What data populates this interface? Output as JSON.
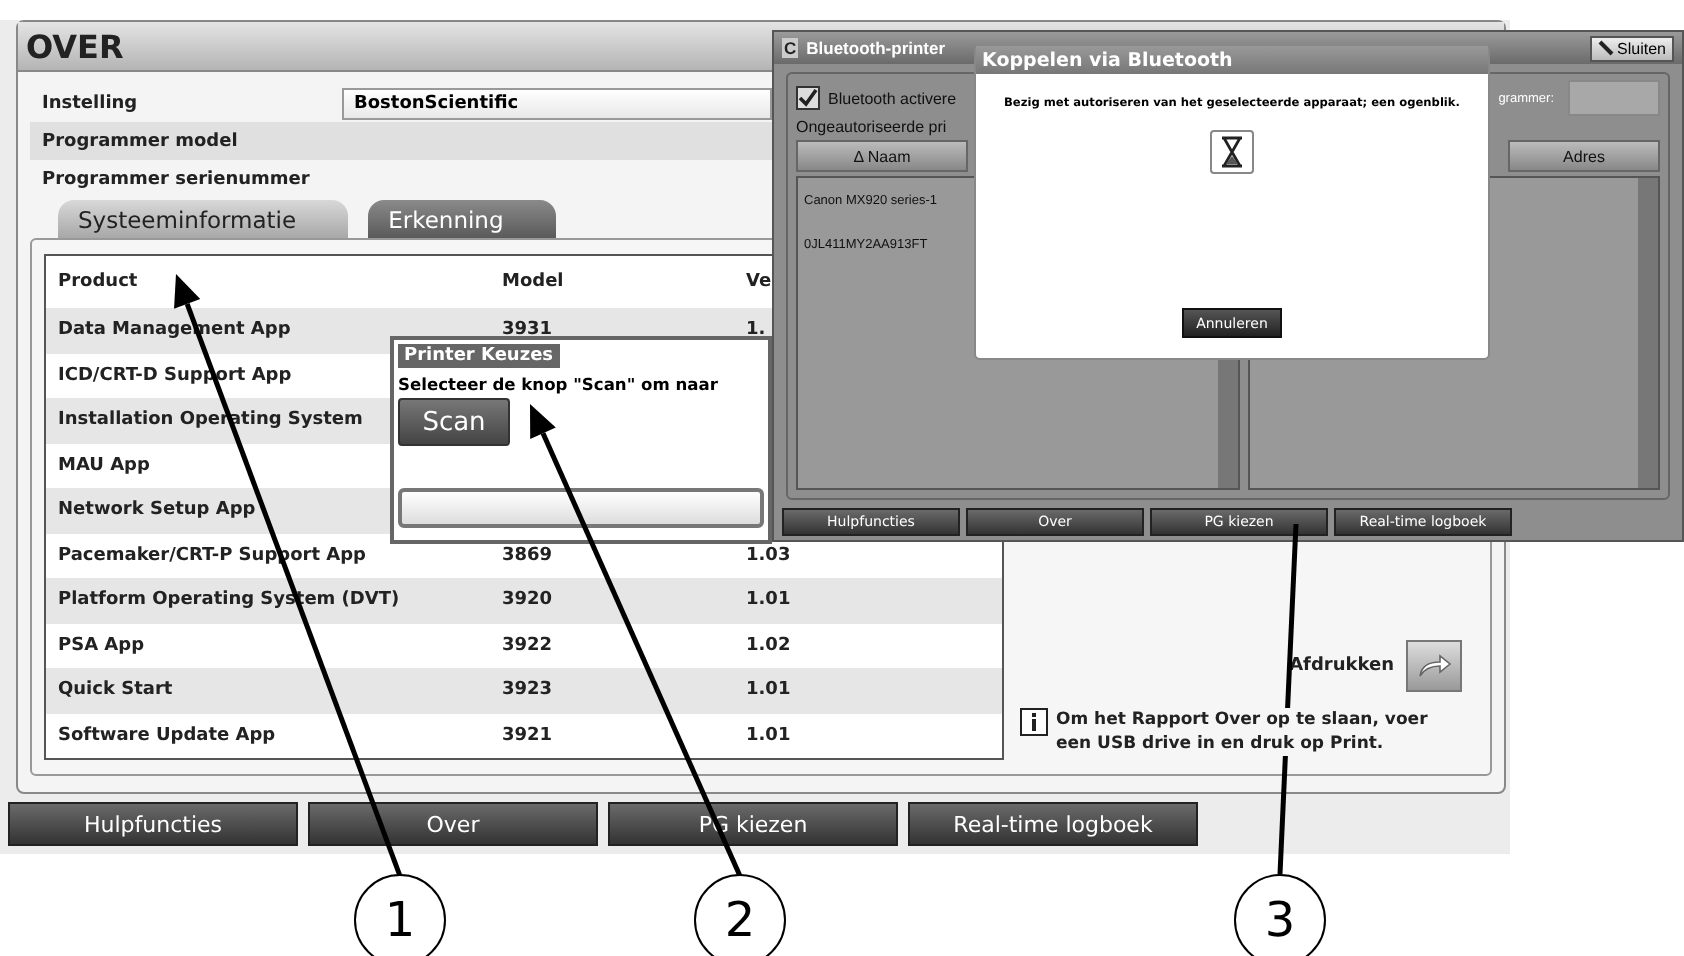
{
  "main_window": {
    "title": "OVER",
    "fields": [
      {
        "label": "Instelling",
        "value": "BostonScientific"
      },
      {
        "label": "Programmer model"
      },
      {
        "label": "Programmer serienummer"
      }
    ],
    "tabs": [
      {
        "label": "Systeeminformatie",
        "selected": true
      },
      {
        "label": "Erkenning",
        "selected": false
      }
    ],
    "table": {
      "columns": [
        "Product",
        "Model",
        "Ve"
      ],
      "rows": [
        {
          "product": "Data Management App",
          "model": "3931",
          "version": "1."
        },
        {
          "product": "ICD/CRT-D Support App"
        },
        {
          "product": "Installation Operating System"
        },
        {
          "product": "MAU App"
        },
        {
          "product": "Network Setup App"
        },
        {
          "product": "Pacemaker/CRT-P Support App",
          "model": "3869",
          "version": "1.03"
        },
        {
          "product": "Platform Operating System (DVT)",
          "model": "3920",
          "version": "1.01"
        },
        {
          "product": "PSA App",
          "model": "3922",
          "version": "1.02"
        },
        {
          "product": "Quick Start",
          "model": "3923",
          "version": "1.01"
        },
        {
          "product": "Software Update App",
          "model": "3921",
          "version": "1.01"
        }
      ]
    },
    "print_label": "Afdrukken",
    "info": "Om het Rapport Over op te slaan, voer een USB drive in en druk op Print."
  },
  "bottom_bar": [
    "Hulpfuncties",
    "Over",
    "PG kiezen",
    "Real-time logboek"
  ],
  "printer_dialog": {
    "title": "Printer Keuzes",
    "message": "Selecteer de knop \"Scan\" om naar",
    "button": "Scan"
  },
  "bluetooth_window": {
    "title_prefix": "C",
    "title": "Bluetooth-printer",
    "close": "Sluiten",
    "checkbox": {
      "label": "Bluetooth activere",
      "checked": true
    },
    "section": "Ongeautoriseerde pri",
    "programmer_label": "grammer:",
    "sort_marker": "Δ",
    "columns": [
      "Naam",
      "Adres"
    ],
    "devices": [
      "Canon MX920 series-1",
      "0JL411MY2AA913FT"
    ],
    "bottom_bar": [
      "Hulpfuncties",
      "Over",
      "PG kiezen",
      "Real-time logboek"
    ]
  },
  "pairing_dialog": {
    "title": "Koppelen via Bluetooth",
    "message": "Bezig met autoriseren van het geselecteerde apparaat; een ogenblik.",
    "button": "Annuleren"
  },
  "callouts": [
    "1",
    "2",
    "3"
  ]
}
